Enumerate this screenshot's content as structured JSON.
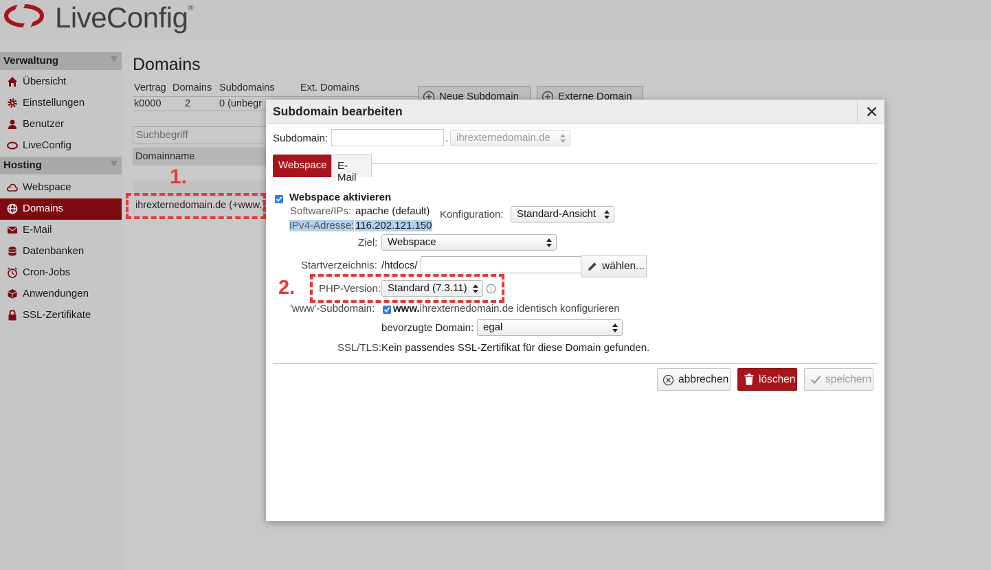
{
  "app": {
    "logo_text": "LiveConfig",
    "logo_mark": "®"
  },
  "sidebar": {
    "sections": [
      {
        "title": "Verwaltung"
      },
      {
        "title": "Hosting"
      }
    ],
    "verwaltung_items": [
      {
        "label": "Übersicht",
        "icon": "home-icon"
      },
      {
        "label": "Einstellungen",
        "icon": "gear-icon"
      },
      {
        "label": "Benutzer",
        "icon": "user-icon"
      },
      {
        "label": "LiveConfig",
        "icon": "liveconfig-icon"
      }
    ],
    "hosting_items": [
      {
        "label": "Webspace",
        "icon": "cloud-icon"
      },
      {
        "label": "Domains",
        "icon": "globe-icon",
        "active": true
      },
      {
        "label": "E-Mail",
        "icon": "envelope-icon"
      },
      {
        "label": "Datenbanken",
        "icon": "database-icon"
      },
      {
        "label": "Cron-Jobs",
        "icon": "clock-icon"
      },
      {
        "label": "Anwendungen",
        "icon": "cube-icon"
      },
      {
        "label": "SSL-Zertifikate",
        "icon": "lock-icon"
      }
    ]
  },
  "main": {
    "title": "Domains",
    "stats_headers": [
      "Vertrag",
      "Domains",
      "Subdomains",
      "Ext. Domains"
    ],
    "stats_values": [
      "k0000",
      "2",
      "0 (unbegr"
    ],
    "buttons": {
      "new_subdomain": "Neue Subdomain",
      "external_domain": "Externe Domain"
    },
    "search_placeholder": "Suchbegriff",
    "list_header": "Domainname",
    "domain_row": "ihrexternedomain.de (+www.)"
  },
  "annotations": {
    "step1": "1.",
    "step2": "2."
  },
  "modal": {
    "title": "Subdomain bearbeiten",
    "subdomain_label": "Subdomain:",
    "subdomain_value": "",
    "dot": ".",
    "domain_select": "ihrexternedomain.de",
    "tabs": [
      "Webspace",
      "E-Mail"
    ],
    "webspace_activate": "Webspace aktivieren",
    "software_label": "Software/IPs:",
    "software_value": "apache (default)",
    "ipv4_label": "IPv4-Adresse:",
    "ipv4_value": "116.202.121.150",
    "config_label": "Konfiguration:",
    "config_value": "Standard-Ansicht",
    "ziel_label": "Ziel:",
    "ziel_value": "Webspace",
    "start_label": "Startverzeichnis:",
    "start_prefix": "/htdocs/",
    "start_value": "",
    "choose_button": "wählen...",
    "php_label": "PHP-Version:",
    "php_value": "Standard (7.3.11)",
    "www_label": "'www'-Subdomain:",
    "www_bold": "www.",
    "www_rest": "ihrexternedomain.de identisch konfigurieren",
    "preferred_label": "bevorzugte Domain:",
    "preferred_value": "egal",
    "ssl_label": "SSL/TLS:",
    "ssl_value": "Kein passendes SSL-Zertifikat für diese Domain gefunden.",
    "btn_cancel": "abbrechen",
    "btn_delete": "löschen",
    "btn_save": "speichern"
  },
  "colors": {
    "brand_red": "#a6151b",
    "active_bg": "#7d0a0f",
    "annotation": "#e53a36",
    "checkbox": "#2f7ee0"
  }
}
